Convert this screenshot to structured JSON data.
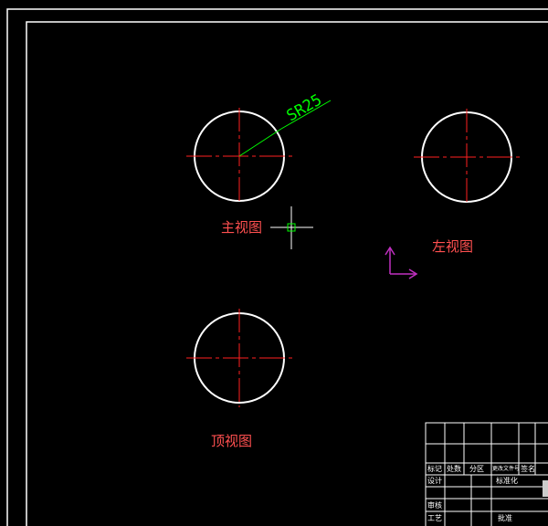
{
  "drawing": {
    "background_color": "#000000",
    "frame_color": "#ffffff",
    "circle_color": "#ffffff",
    "centerline_color": "#ff2020",
    "dimension_color": "#00ff00",
    "label_color": "#ff5050",
    "ucs_color": "#c030c0",
    "views": [
      {
        "id": "main",
        "label": "主视图"
      },
      {
        "id": "left",
        "label": "左视图"
      },
      {
        "id": "top",
        "label": "顶视图"
      }
    ],
    "dimension": {
      "text": "SR25"
    },
    "title_block": {
      "cells": [
        "标记",
        "处数",
        "分区",
        "更改文件号",
        "签名",
        "设计",
        "标准化",
        "审核",
        "工艺",
        "批准"
      ]
    }
  }
}
